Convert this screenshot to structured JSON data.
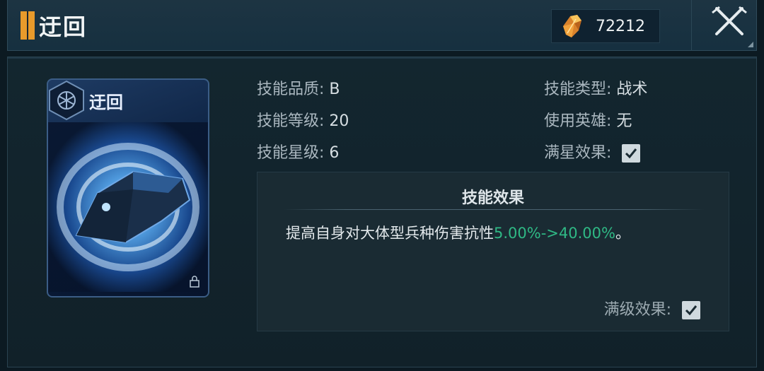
{
  "header": {
    "title": "迂回",
    "currency_value": "72212"
  },
  "card": {
    "name": "迂回"
  },
  "stats": {
    "quality_label": "技能品质:",
    "quality_value": "B",
    "level_label": "技能等级:",
    "level_value": "20",
    "star_label": "技能星级:",
    "star_value": "6",
    "type_label": "技能类型:",
    "type_value": "战术",
    "hero_label": "使用英雄:",
    "hero_value": "无",
    "max_star_label": "满星效果:"
  },
  "effect": {
    "title": "技能效果",
    "text_prefix": "提高自身对大体型兵种伤害抗性",
    "text_highlight": "5.00%->40.00%",
    "text_suffix": "。",
    "max_level_label": "满级效果:"
  },
  "colors": {
    "accent_orange": "#e89a2b",
    "highlight_green": "#2fb985",
    "card_blue": "#1e3b63"
  },
  "icons": {
    "currency": "crystal-shard-icon",
    "close": "crossed-swords-close-icon",
    "card_badge": "hexagon-emblem-icon",
    "check": "checkbox-checked-icon",
    "lock": "lock-icon"
  }
}
